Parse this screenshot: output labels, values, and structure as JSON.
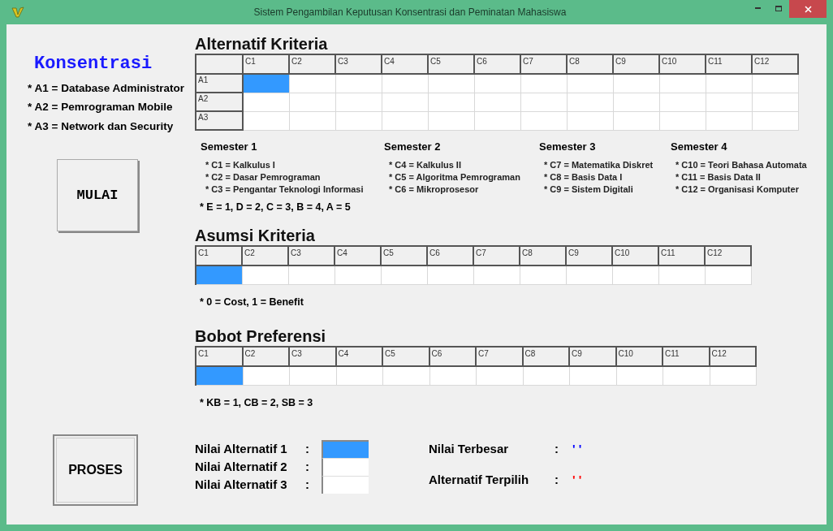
{
  "window": {
    "title": "Sistem Pengambilan Keputusan Konsentrasi dan Peminatan Mahasiswa"
  },
  "konsentrasi": {
    "title": "Konsentrasi",
    "items": [
      "* A1 = Database Administrator",
      "* A2 = Pemrograman Mobile",
      "* A3 = Network dan Security"
    ]
  },
  "buttons": {
    "start": "MULAI",
    "process": "PROSES"
  },
  "alternatif_kriteria": {
    "title": "Alternatif Kriteria",
    "columns": [
      "C1",
      "C2",
      "C3",
      "C4",
      "C5",
      "C6",
      "C7",
      "C8",
      "C9",
      "C10",
      "C11",
      "C12"
    ],
    "rows": [
      {
        "label": "A1",
        "cells": [
          {
            "selected": true
          },
          {
            "selected": false
          },
          {
            "selected": false
          },
          {
            "selected": false
          },
          {
            "selected": false
          },
          {
            "selected": false
          },
          {
            "selected": false
          },
          {
            "selected": false
          },
          {
            "selected": false
          },
          {
            "selected": false
          },
          {
            "selected": false
          },
          {
            "selected": false
          }
        ]
      },
      {
        "label": "A2",
        "cells": [
          {
            "selected": false
          },
          {
            "selected": false
          },
          {
            "selected": false
          },
          {
            "selected": false
          },
          {
            "selected": false
          },
          {
            "selected": false
          },
          {
            "selected": false
          },
          {
            "selected": false
          },
          {
            "selected": false
          },
          {
            "selected": false
          },
          {
            "selected": false
          },
          {
            "selected": false
          }
        ]
      },
      {
        "label": "A3",
        "cells": [
          {
            "selected": false
          },
          {
            "selected": false
          },
          {
            "selected": false
          },
          {
            "selected": false
          },
          {
            "selected": false
          },
          {
            "selected": false
          },
          {
            "selected": false
          },
          {
            "selected": false
          },
          {
            "selected": false
          },
          {
            "selected": false
          },
          {
            "selected": false
          },
          {
            "selected": false
          }
        ]
      }
    ]
  },
  "semesters": [
    {
      "title": "Semester 1",
      "items": [
        "* C1 = Kalkulus I",
        "* C2 = Dasar Pemrograman",
        "* C3 = Pengantar Teknologi Informasi"
      ]
    },
    {
      "title": "Semester 2",
      "items": [
        "* C4 = Kalkulus II",
        "* C5 = Algoritma Pemrograman",
        "* C6 = Mikroprosesor"
      ]
    },
    {
      "title": "Semester 3",
      "items": [
        "* C7 = Matematika Diskret",
        "* C8 = Basis Data I",
        "* C9 = Sistem Digitali"
      ]
    },
    {
      "title": "Semester 4",
      "items": [
        "* C10 = Teori Bahasa Automata",
        "* C11 = Basis Data II",
        "* C12 = Organisasi Komputer"
      ]
    }
  ],
  "grade_note": "* E = 1, D = 2, C = 3, B = 4, A = 5",
  "asumsi_kriteria": {
    "title": "Asumsi Kriteria",
    "columns": [
      "C1",
      "C2",
      "C3",
      "C4",
      "C5",
      "C6",
      "C7",
      "C8",
      "C9",
      "C10",
      "C11",
      "C12"
    ],
    "cells": [
      {
        "selected": true
      },
      {
        "selected": false
      },
      {
        "selected": false
      },
      {
        "selected": false
      },
      {
        "selected": false
      },
      {
        "selected": false
      },
      {
        "selected": false
      },
      {
        "selected": false
      },
      {
        "selected": false
      },
      {
        "selected": false
      },
      {
        "selected": false
      },
      {
        "selected": false
      }
    ],
    "note": "* 0 = Cost, 1 = Benefit"
  },
  "bobot_preferensi": {
    "title": "Bobot Preferensi",
    "columns": [
      "C1",
      "C2",
      "C3",
      "C4",
      "C5",
      "C6",
      "C7",
      "C8",
      "C9",
      "C10",
      "C11",
      "C12"
    ],
    "cells": [
      {
        "selected": true
      },
      {
        "selected": false
      },
      {
        "selected": false
      },
      {
        "selected": false
      },
      {
        "selected": false
      },
      {
        "selected": false
      },
      {
        "selected": false
      },
      {
        "selected": false
      },
      {
        "selected": false
      },
      {
        "selected": false
      },
      {
        "selected": false
      },
      {
        "selected": false
      }
    ],
    "note": "* KB = 1, CB = 2, SB = 3"
  },
  "nilai_alternatif": [
    {
      "label": "Nilai Alternatif 1",
      "separator": ":",
      "selected": true
    },
    {
      "label": "Nilai Alternatif 2",
      "separator": ":",
      "selected": false
    },
    {
      "label": "Nilai Alternatif 3",
      "separator": ":",
      "selected": false
    }
  ],
  "results": [
    {
      "label": "Nilai Terbesar",
      "separator": ":",
      "value": "' '",
      "color": "#0000ff"
    },
    {
      "label": "Alternatif Terpilih",
      "separator": ":",
      "value": "' '",
      "color": "#ff0000"
    }
  ]
}
